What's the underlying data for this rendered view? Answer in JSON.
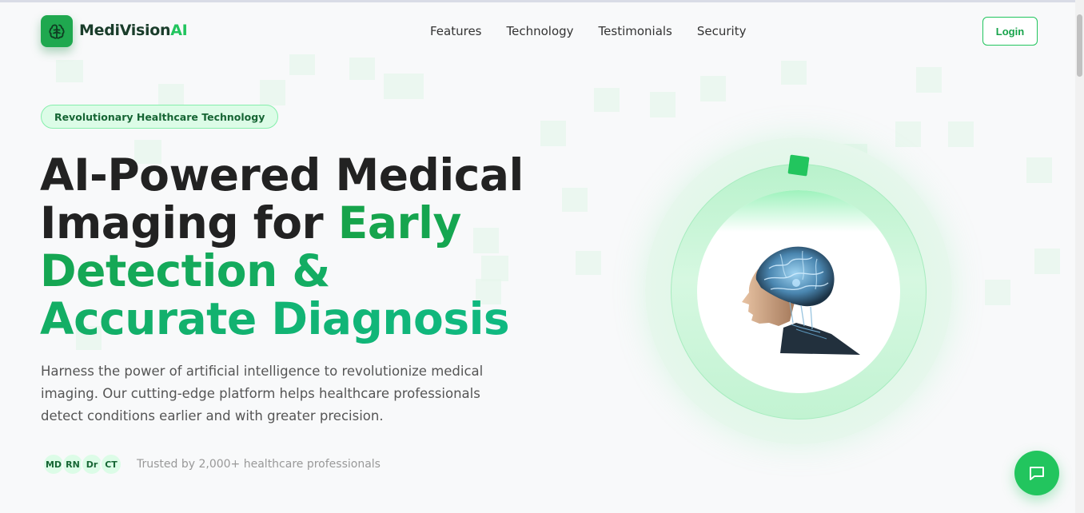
{
  "header": {
    "logo_name": "MediVision",
    "logo_suffix": "AI",
    "login_label": "Login"
  },
  "nav": {
    "items": [
      {
        "label": "Features"
      },
      {
        "label": "Technology"
      },
      {
        "label": "Testimonials"
      },
      {
        "label": "Security"
      }
    ]
  },
  "hero": {
    "badge": "Revolutionary Healthcare Technology",
    "headline_plain": "AI-Powered Medical Imaging for ",
    "headline_highlight": "Early Detection & Accurate Diagnosis",
    "lead": "Harness the power of artificial intelligence to revolutionize medical imaging. Our cutting-edge platform helps healthcare professionals detect conditions earlier and with greater precision.",
    "avatars": [
      "MD",
      "RN",
      "Dr",
      "CT"
    ],
    "trusted_text": "Trusted by 2,000+ healthcare professionals"
  },
  "icons": {
    "logo": "brain-icon",
    "chat": "chat-bubble-icon"
  },
  "colors": {
    "brand": "#1fa84f",
    "accent": "#22c55e",
    "text_dark": "#222222",
    "badge_bg": "#dcfce7"
  }
}
